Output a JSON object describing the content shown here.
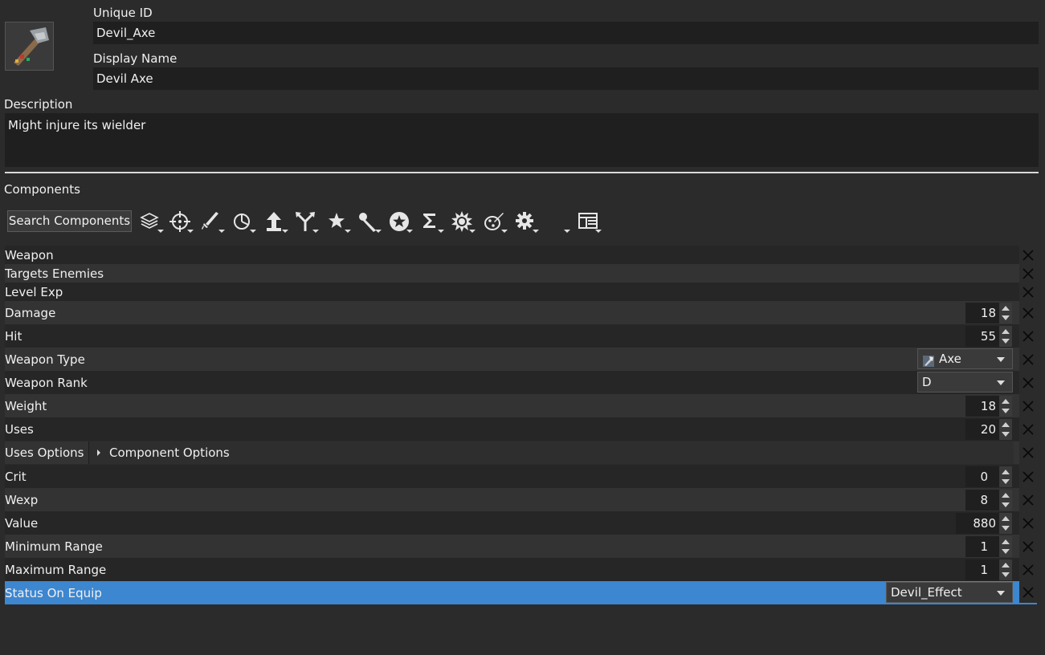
{
  "header": {
    "unique_id_label": "Unique ID",
    "unique_id_value": "Devil_Axe",
    "display_name_label": "Display Name",
    "display_name_value": "Devil Axe",
    "description_label": "Description",
    "description_value": "Might injure its wielder"
  },
  "components": {
    "title": "Components",
    "search_label": "Search Components",
    "toolbar_icons": [
      "layers-icon",
      "crosshair-icon",
      "sword-icon",
      "pie-icon",
      "level-up-icon",
      "branch-icon",
      "star-icon",
      "staff-icon",
      "badge-star-icon",
      "sigma-icon",
      "burst-icon",
      "palette-icon",
      "gear-icon",
      "blank-dropdown-icon",
      "layout-icon"
    ],
    "rows": [
      {
        "label": "Weapon"
      },
      {
        "label": "Targets Enemies"
      },
      {
        "label": "Level Exp"
      },
      {
        "label": "Damage",
        "value": "18"
      },
      {
        "label": "Hit",
        "value": "55"
      },
      {
        "label": "Weapon Type",
        "select": "Axe"
      },
      {
        "label": "Weapon Rank",
        "select": "D"
      },
      {
        "label": "Weight",
        "value": "18"
      },
      {
        "label": "Uses",
        "value": "20"
      },
      {
        "label": "Uses Options",
        "sub": "Component Options"
      },
      {
        "label": "Crit",
        "value": "0"
      },
      {
        "label": "Wexp",
        "value": "8"
      },
      {
        "label": "Value",
        "value": "880"
      },
      {
        "label": "Minimum Range",
        "value": "1"
      },
      {
        "label": "Maximum Range",
        "value": "1"
      },
      {
        "label": "Status On Equip",
        "select": "Devil_Effect"
      }
    ]
  },
  "colors": {
    "background": "#2b2b2b",
    "field": "#1f1f1f",
    "row_dark": "#262626",
    "row_light": "#333333",
    "selected": "#3d86d0"
  }
}
